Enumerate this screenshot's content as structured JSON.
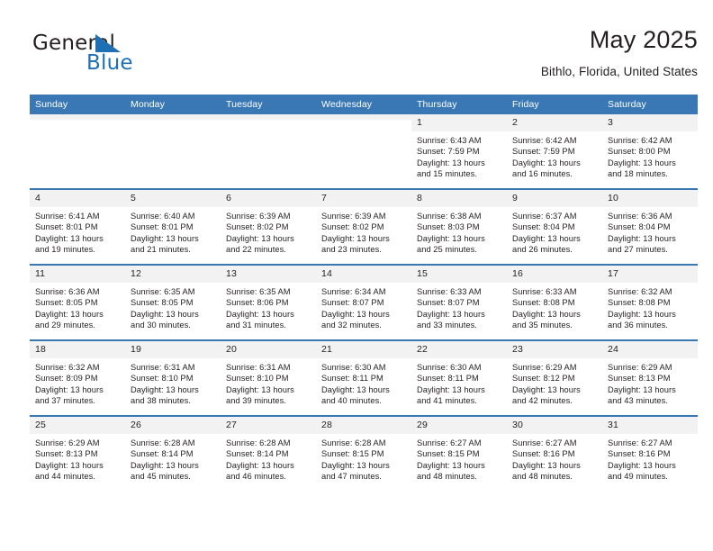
{
  "brand": {
    "word_one": "General",
    "word_two": "Blue",
    "flag_color": "#1f6fb4",
    "icon": "triangle-flag-icon"
  },
  "header": {
    "title": "May 2025",
    "location": "Bithlo, Florida, United States"
  },
  "theme": {
    "header_blue": "#3a78b5",
    "daynum_band": "#f2f2f2",
    "text": "#231f20"
  },
  "calendar": {
    "weekday_headers": [
      "Sunday",
      "Monday",
      "Tuesday",
      "Wednesday",
      "Thursday",
      "Friday",
      "Saturday"
    ],
    "weeks": [
      [
        {
          "day": "",
          "lines": []
        },
        {
          "day": "",
          "lines": []
        },
        {
          "day": "",
          "lines": []
        },
        {
          "day": "",
          "lines": []
        },
        {
          "day": "1",
          "lines": [
            "Sunrise: 6:43 AM",
            "Sunset: 7:59 PM",
            "Daylight: 13 hours",
            "and 15 minutes."
          ]
        },
        {
          "day": "2",
          "lines": [
            "Sunrise: 6:42 AM",
            "Sunset: 7:59 PM",
            "Daylight: 13 hours",
            "and 16 minutes."
          ]
        },
        {
          "day": "3",
          "lines": [
            "Sunrise: 6:42 AM",
            "Sunset: 8:00 PM",
            "Daylight: 13 hours",
            "and 18 minutes."
          ]
        }
      ],
      [
        {
          "day": "4",
          "lines": [
            "Sunrise: 6:41 AM",
            "Sunset: 8:01 PM",
            "Daylight: 13 hours",
            "and 19 minutes."
          ]
        },
        {
          "day": "5",
          "lines": [
            "Sunrise: 6:40 AM",
            "Sunset: 8:01 PM",
            "Daylight: 13 hours",
            "and 21 minutes."
          ]
        },
        {
          "day": "6",
          "lines": [
            "Sunrise: 6:39 AM",
            "Sunset: 8:02 PM",
            "Daylight: 13 hours",
            "and 22 minutes."
          ]
        },
        {
          "day": "7",
          "lines": [
            "Sunrise: 6:39 AM",
            "Sunset: 8:02 PM",
            "Daylight: 13 hours",
            "and 23 minutes."
          ]
        },
        {
          "day": "8",
          "lines": [
            "Sunrise: 6:38 AM",
            "Sunset: 8:03 PM",
            "Daylight: 13 hours",
            "and 25 minutes."
          ]
        },
        {
          "day": "9",
          "lines": [
            "Sunrise: 6:37 AM",
            "Sunset: 8:04 PM",
            "Daylight: 13 hours",
            "and 26 minutes."
          ]
        },
        {
          "day": "10",
          "lines": [
            "Sunrise: 6:36 AM",
            "Sunset: 8:04 PM",
            "Daylight: 13 hours",
            "and 27 minutes."
          ]
        }
      ],
      [
        {
          "day": "11",
          "lines": [
            "Sunrise: 6:36 AM",
            "Sunset: 8:05 PM",
            "Daylight: 13 hours",
            "and 29 minutes."
          ]
        },
        {
          "day": "12",
          "lines": [
            "Sunrise: 6:35 AM",
            "Sunset: 8:05 PM",
            "Daylight: 13 hours",
            "and 30 minutes."
          ]
        },
        {
          "day": "13",
          "lines": [
            "Sunrise: 6:35 AM",
            "Sunset: 8:06 PM",
            "Daylight: 13 hours",
            "and 31 minutes."
          ]
        },
        {
          "day": "14",
          "lines": [
            "Sunrise: 6:34 AM",
            "Sunset: 8:07 PM",
            "Daylight: 13 hours",
            "and 32 minutes."
          ]
        },
        {
          "day": "15",
          "lines": [
            "Sunrise: 6:33 AM",
            "Sunset: 8:07 PM",
            "Daylight: 13 hours",
            "and 33 minutes."
          ]
        },
        {
          "day": "16",
          "lines": [
            "Sunrise: 6:33 AM",
            "Sunset: 8:08 PM",
            "Daylight: 13 hours",
            "and 35 minutes."
          ]
        },
        {
          "day": "17",
          "lines": [
            "Sunrise: 6:32 AM",
            "Sunset: 8:08 PM",
            "Daylight: 13 hours",
            "and 36 minutes."
          ]
        }
      ],
      [
        {
          "day": "18",
          "lines": [
            "Sunrise: 6:32 AM",
            "Sunset: 8:09 PM",
            "Daylight: 13 hours",
            "and 37 minutes."
          ]
        },
        {
          "day": "19",
          "lines": [
            "Sunrise: 6:31 AM",
            "Sunset: 8:10 PM",
            "Daylight: 13 hours",
            "and 38 minutes."
          ]
        },
        {
          "day": "20",
          "lines": [
            "Sunrise: 6:31 AM",
            "Sunset: 8:10 PM",
            "Daylight: 13 hours",
            "and 39 minutes."
          ]
        },
        {
          "day": "21",
          "lines": [
            "Sunrise: 6:30 AM",
            "Sunset: 8:11 PM",
            "Daylight: 13 hours",
            "and 40 minutes."
          ]
        },
        {
          "day": "22",
          "lines": [
            "Sunrise: 6:30 AM",
            "Sunset: 8:11 PM",
            "Daylight: 13 hours",
            "and 41 minutes."
          ]
        },
        {
          "day": "23",
          "lines": [
            "Sunrise: 6:29 AM",
            "Sunset: 8:12 PM",
            "Daylight: 13 hours",
            "and 42 minutes."
          ]
        },
        {
          "day": "24",
          "lines": [
            "Sunrise: 6:29 AM",
            "Sunset: 8:13 PM",
            "Daylight: 13 hours",
            "and 43 minutes."
          ]
        }
      ],
      [
        {
          "day": "25",
          "lines": [
            "Sunrise: 6:29 AM",
            "Sunset: 8:13 PM",
            "Daylight: 13 hours",
            "and 44 minutes."
          ]
        },
        {
          "day": "26",
          "lines": [
            "Sunrise: 6:28 AM",
            "Sunset: 8:14 PM",
            "Daylight: 13 hours",
            "and 45 minutes."
          ]
        },
        {
          "day": "27",
          "lines": [
            "Sunrise: 6:28 AM",
            "Sunset: 8:14 PM",
            "Daylight: 13 hours",
            "and 46 minutes."
          ]
        },
        {
          "day": "28",
          "lines": [
            "Sunrise: 6:28 AM",
            "Sunset: 8:15 PM",
            "Daylight: 13 hours",
            "and 47 minutes."
          ]
        },
        {
          "day": "29",
          "lines": [
            "Sunrise: 6:27 AM",
            "Sunset: 8:15 PM",
            "Daylight: 13 hours",
            "and 48 minutes."
          ]
        },
        {
          "day": "30",
          "lines": [
            "Sunrise: 6:27 AM",
            "Sunset: 8:16 PM",
            "Daylight: 13 hours",
            "and 48 minutes."
          ]
        },
        {
          "day": "31",
          "lines": [
            "Sunrise: 6:27 AM",
            "Sunset: 8:16 PM",
            "Daylight: 13 hours",
            "and 49 minutes."
          ]
        }
      ]
    ]
  }
}
